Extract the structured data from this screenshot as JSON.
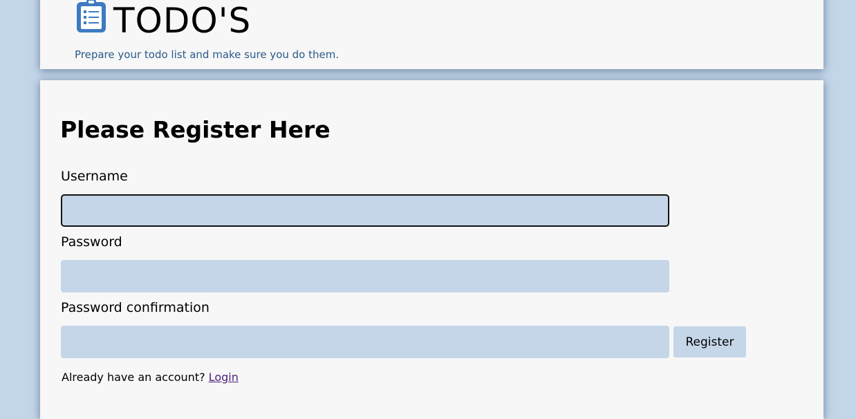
{
  "header": {
    "title": "TODO'S",
    "subtitle": "Prepare your todo list and make sure you do them.",
    "logo_icon": "clipboard-list-icon"
  },
  "form": {
    "heading": "Please Register Here",
    "username_label": "Username",
    "username_value": "",
    "password_label": "Password",
    "password_value": "",
    "password_confirmation_label": "Password confirmation",
    "password_confirmation_value": "",
    "submit_label": "Register",
    "login_prompt": "Already have an account?",
    "login_link": "Login"
  },
  "colors": {
    "background": "#c3d6e8",
    "card": "#f7f7f7",
    "input": "#c5d6e8",
    "subtitle": "#2a5a8a",
    "link": "#4b1f7a",
    "logo": "#3d7bc0"
  }
}
